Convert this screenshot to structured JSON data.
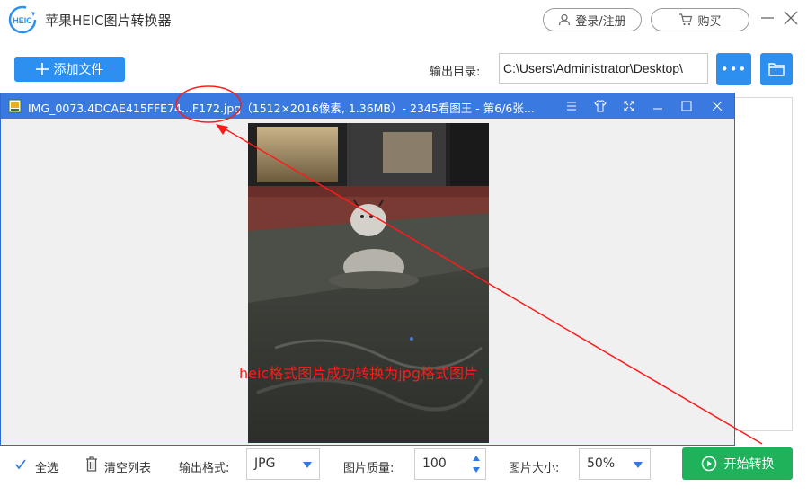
{
  "app": {
    "title": "苹果HEIC图片转换器",
    "logo_text": "HEIC"
  },
  "header": {
    "login_label": "登录/注册",
    "buy_label": "购买"
  },
  "toolbar": {
    "add_label": "添加文件",
    "output_dir_label": "输出目录:",
    "output_dir_value": "C:\\Users\\Administrator\\Desktop\\",
    "more_label": "•••"
  },
  "viewer": {
    "title": "IMG_0073.4DCAE415FFE74...F172.jpg（1512×2016像素, 1.36MB）- 2345看图王 - 第6/6张..."
  },
  "annotation": {
    "text": "heic格式图片成功转换为jpg格式图片",
    "color": "#ff1a1a"
  },
  "bottom": {
    "select_all_label": "全选",
    "clear_list_label": "清空列表",
    "output_format_label": "输出格式:",
    "output_format_value": "JPG",
    "quality_label": "图片质量:",
    "quality_value": "100",
    "size_label": "图片大小:",
    "size_value": "50%",
    "start_label": "开始转换"
  },
  "colors": {
    "accent": "#2d8ff0",
    "start": "#1fb25a",
    "viewer_bar": "#3a7ae0"
  }
}
